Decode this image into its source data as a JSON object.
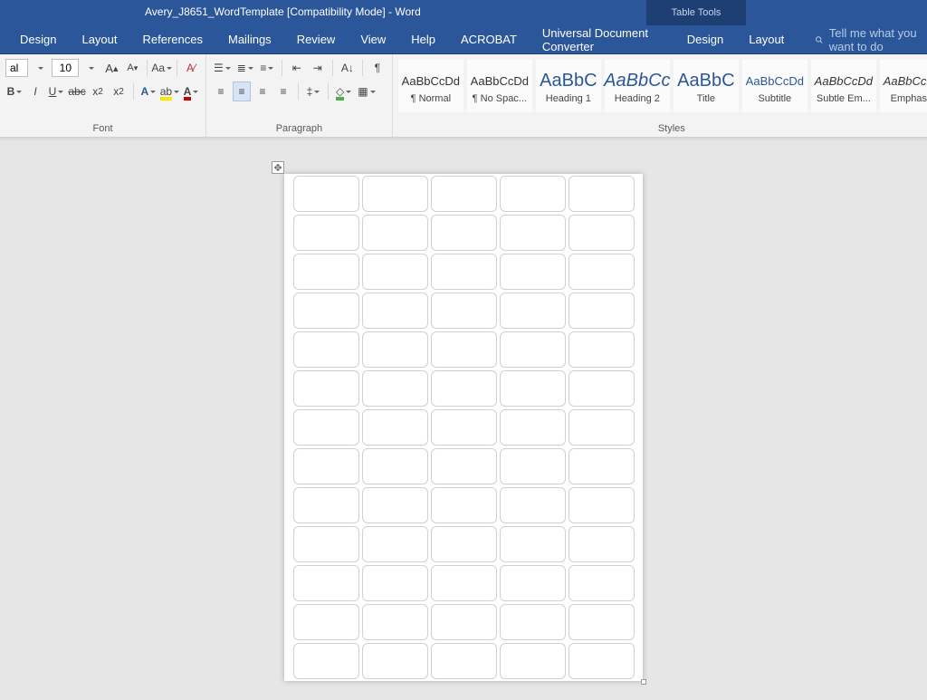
{
  "title": "Avery_J8651_WordTemplate [Compatibility Mode]  -  Word",
  "table_tools": "Table Tools",
  "tabs": [
    "Design",
    "Layout",
    "References",
    "Mailings",
    "Review",
    "View",
    "Help",
    "ACROBAT",
    "Universal Document Converter",
    "Design",
    "Layout"
  ],
  "tell_me": "Tell me what you want to do",
  "font": {
    "name_value": "al",
    "size_value": "10",
    "group_label": "Font"
  },
  "paragraph": {
    "group_label": "Paragraph"
  },
  "styles": {
    "group_label": "Styles",
    "items": [
      {
        "preview": "AaBbCcDd",
        "name": "¶ Normal",
        "cls": ""
      },
      {
        "preview": "AaBbCcDd",
        "name": "¶ No Spac...",
        "cls": ""
      },
      {
        "preview": "AaBbC",
        "name": "Heading 1",
        "cls": "big"
      },
      {
        "preview": "AaBbCc",
        "name": "Heading 2",
        "cls": "big italic"
      },
      {
        "preview": "AaBbC",
        "name": "Title",
        "cls": "big"
      },
      {
        "preview": "AaBbCcDd",
        "name": "Subtitle",
        "cls": "blue"
      },
      {
        "preview": "AaBbCcDd",
        "name": "Subtle Em...",
        "cls": "italic"
      },
      {
        "preview": "AaBbCcDd",
        "name": "Emphasis",
        "cls": "italic"
      }
    ]
  },
  "label_template": {
    "rows": 13,
    "cols": 5
  }
}
